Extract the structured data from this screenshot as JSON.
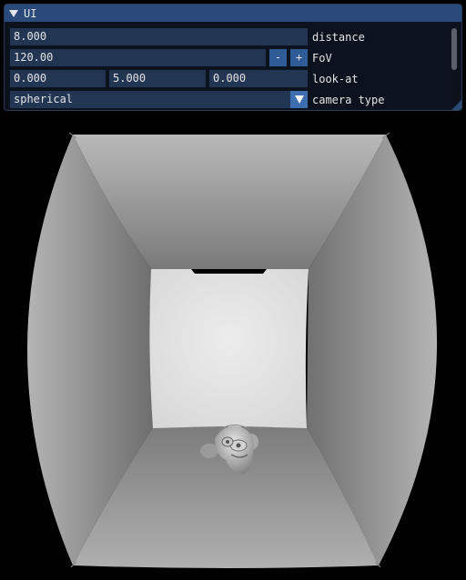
{
  "window": {
    "title": "UI"
  },
  "controls": {
    "distance": {
      "value": "8.000",
      "label": "distance"
    },
    "fov": {
      "value": "120.00",
      "label": "FoV",
      "minus": "-",
      "plus": "+"
    },
    "look_at": {
      "x": "0.000",
      "y": "5.000",
      "z": "0.000",
      "label": "look-at"
    },
    "camera_type": {
      "selected": "spherical",
      "label": "camera type"
    }
  },
  "scene": {
    "description_icon": "suzanne-monkey-head",
    "background_color": "#000000"
  }
}
